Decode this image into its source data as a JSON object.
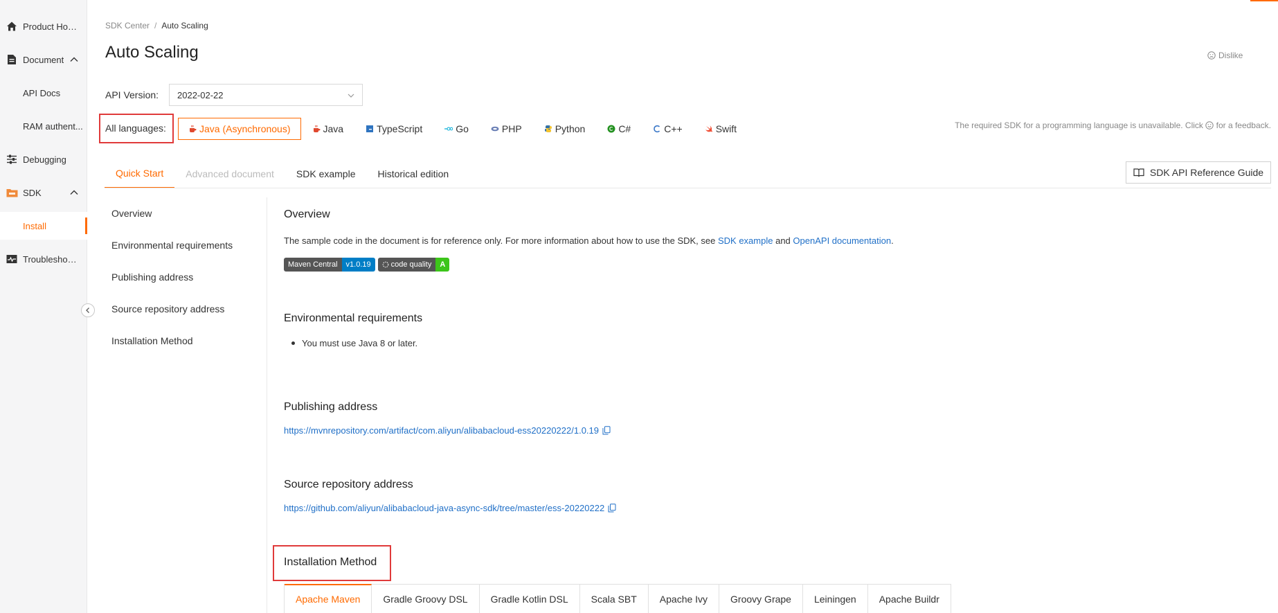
{
  "sidebar": {
    "items": [
      {
        "label": "Product Hom...",
        "icon": "home-icon"
      },
      {
        "label": "Document",
        "icon": "document-icon"
      },
      {
        "label": "API Docs"
      },
      {
        "label": "RAM authent..."
      },
      {
        "label": "Debugging",
        "icon": "sliders-icon"
      },
      {
        "label": "SDK",
        "icon": "sdk-icon"
      },
      {
        "label": "Install"
      },
      {
        "label": "Troubleshoot...",
        "icon": "monitor-icon"
      }
    ]
  },
  "breadcrumb": {
    "parent": "SDK Center",
    "separator": "/",
    "current": "Auto Scaling"
  },
  "page": {
    "title": "Auto Scaling",
    "dislike": "Dislike"
  },
  "api": {
    "label": "API Version:",
    "value": "2022-02-22"
  },
  "languages": {
    "label": "All languages:",
    "items": [
      {
        "label": "Java (Asynchronous)",
        "icon": "java-icon",
        "color": "#e0482e"
      },
      {
        "label": "Java",
        "icon": "java-icon",
        "color": "#e0482e"
      },
      {
        "label": "TypeScript",
        "icon": "typescript-icon",
        "color": "#2f74c0"
      },
      {
        "label": "Go",
        "icon": "go-icon",
        "color": "#00acd7"
      },
      {
        "label": "PHP",
        "icon": "php-icon",
        "color": "#6a7fb5"
      },
      {
        "label": "Python",
        "icon": "python-icon",
        "color": "#3572a5"
      },
      {
        "label": "C#",
        "icon": "csharp-icon",
        "color": "#239120"
      },
      {
        "label": "C++",
        "icon": "cpp-icon",
        "color": "#3b78c8"
      },
      {
        "label": "Swift",
        "icon": "swift-icon",
        "color": "#f05138"
      }
    ],
    "note_before": "The required SDK for a programming language is unavailable. Click",
    "note_after": "for a feedback."
  },
  "tabs": [
    {
      "label": "Quick Start"
    },
    {
      "label": "Advanced document"
    },
    {
      "label": "SDK example"
    },
    {
      "label": "Historical edition"
    }
  ],
  "reference_button": "SDK API Reference Guide",
  "anchors": [
    "Overview",
    "Environmental requirements",
    "Publishing address",
    "Source repository address",
    "Installation Method"
  ],
  "overview": {
    "title": "Overview",
    "text_before": "The sample code in the document is for reference only. For more information about how to use the SDK, see",
    "link1": "SDK example",
    "and": "and",
    "link2": "OpenAPI documentation",
    "end": ".",
    "badge1_left": "Maven Central",
    "badge1_right": "v1.0.19",
    "badge2_left": "code quality",
    "badge2_right": "A"
  },
  "env": {
    "title": "Environmental requirements",
    "item": "You must use Java 8 or later."
  },
  "publishing": {
    "title": "Publishing address",
    "url": "https://mvnrepository.com/artifact/com.aliyun/alibabacloud-ess20220222/1.0.19"
  },
  "source": {
    "title": "Source repository address",
    "url": "https://github.com/aliyun/alibabacloud-java-async-sdk/tree/master/ess-20220222"
  },
  "installation": {
    "title": "Installation Method",
    "tabs": [
      "Apache Maven",
      "Gradle Groovy DSL",
      "Gradle Kotlin DSL",
      "Scala SBT",
      "Apache Ivy",
      "Groovy Grape",
      "Leiningen",
      "Apache Buildr"
    ]
  },
  "colors": {
    "accent": "#ff6a00",
    "link": "#1f6fc7",
    "highlight": "#e03a3a"
  }
}
